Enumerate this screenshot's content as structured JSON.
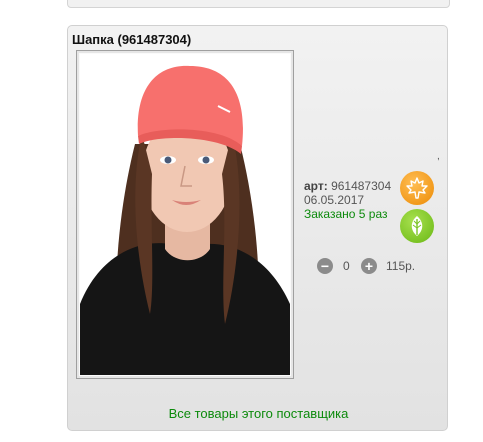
{
  "product": {
    "title": "Шапка (961487304)",
    "dot": ",",
    "art_label": "арт:",
    "art_number": "961487304",
    "date": "06.05.2017",
    "ordered": "Заказано 5 раз",
    "quantity": "0",
    "price": "115р.",
    "supplier_link": "Все товары этого поставщика"
  },
  "icons": {
    "badge_season": "maple-leaf-icon",
    "badge_eco": "green-leaf-icon",
    "minus": "minus-circle-icon",
    "plus": "plus-circle-icon"
  },
  "colors": {
    "link_green": "#0c8a0c",
    "badge_orange": "#f29a1c",
    "badge_green": "#7cc425",
    "hat_coral": "#f7706d"
  }
}
